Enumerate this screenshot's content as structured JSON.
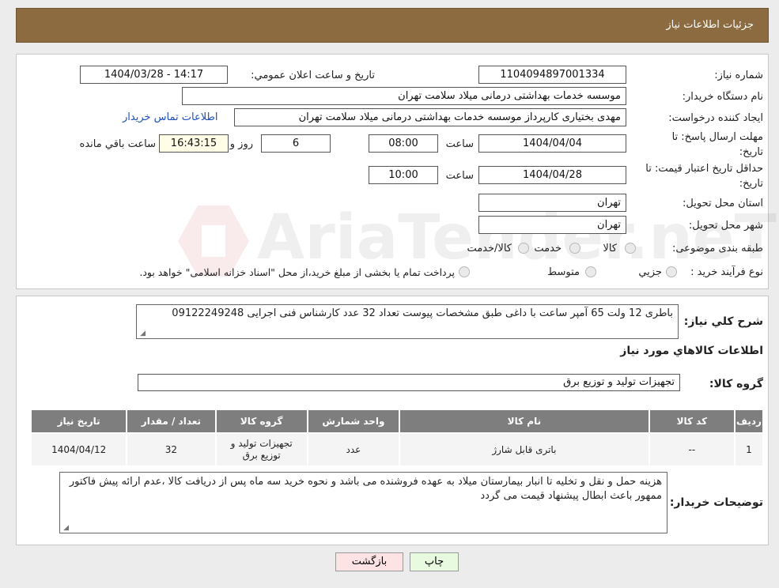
{
  "header": {
    "title": "جزئیات اطلاعات نیاز"
  },
  "watermark_text": "AriaTender.neT",
  "fields": {
    "need_number": {
      "label": "شماره نیاز:",
      "value": "1104094897001334"
    },
    "announce_datetime": {
      "label": "تاریخ و ساعت اعلان عمومي:",
      "value": "1404/03/28 - 14:17"
    },
    "buyer_org": {
      "label": "نام دستگاه خریدار:",
      "value": "موسسه خدمات بهداشتی درمانی میلاد سلامت تهران"
    },
    "requester": {
      "label": "ایجاد کننده درخواست:",
      "value": "مهدی بختیاری کارپرداز موسسه خدمات بهداشتی درمانی میلاد سلامت تهران"
    },
    "buyer_contact_link": "اطلاعات تماس خریدار",
    "reply_deadline": {
      "label_line1": "مهلت ارسال پاسخ: تا",
      "label_line2": "تاریخ:",
      "date": "1404/04/04",
      "time_label": "ساعت",
      "time": "08:00",
      "days": "6",
      "days_label": "روز و",
      "remaining": "16:43:15",
      "remaining_label": "ساعت باقي مانده"
    },
    "price_validity": {
      "label_line1": "حداقل تاریخ اعتبار قیمت: تا",
      "label_line2": "تاریخ:",
      "date": "1404/04/28",
      "time_label": "ساعت",
      "time": "10:00"
    },
    "delivery_province": {
      "label": "استان محل تحویل:",
      "value": "تهران"
    },
    "delivery_city": {
      "label": "شهر محل تحویل:",
      "value": "تهران"
    },
    "category": {
      "label": "طبقه بندی موضوعی:",
      "options": [
        "کالا",
        "خدمت",
        "کالا/خدمت"
      ]
    },
    "purchase_process": {
      "label": "نوع فرآیند خرید :",
      "options": [
        "جزیي",
        "متوسط"
      ],
      "note": "پرداخت تمام یا بخشی از مبلغ خرید،از محل \"اسناد خزانه اسلامی\" خواهد بود."
    }
  },
  "summary": {
    "label": "شرح کلي نیاز:",
    "text": "باطری 12 ولت 65 آمپر ساعت با داغی طبق مشخصات پیوست تعداد 32 عدد کارشناس فنی اجرایی 09122249248"
  },
  "goods_info_title": "اطلاعات کالاهاي مورد نیاز",
  "goods_group": {
    "label": "گروه کالا:",
    "value": "تجهیزات تولید و توزیع برق"
  },
  "table": {
    "headers": [
      "ردیف",
      "کد کالا",
      "نام کالا",
      "واحد شمارش",
      "گروه کالا",
      "تعداد / مقدار",
      "تاریخ نیاز"
    ],
    "rows": [
      [
        "1",
        "--",
        "باتری قابل شارژ",
        "عدد",
        "تجهیزات تولید و توزیع برق",
        "32",
        "1404/04/12"
      ]
    ]
  },
  "buyer_notes": {
    "label": "توضیحات خریدار:",
    "text": "هزینه حمل و نقل و تخلیه تا انبار بیمارستان میلاد به عهده فروشنده می باشد و نحوه خرید سه ماه پس از دریافت کالا ،عدم ارائه پیش فاکتور ممهور باعث ابطال پیشنهاد قیمت می گردد"
  },
  "buttons": {
    "print": "چاپ",
    "back": "بازگشت"
  },
  "colors": {
    "header_bg": "#8b6b3f",
    "link": "#1e4fb8",
    "print_bg": "#e8fbe0",
    "back_bg": "#fde3e3"
  }
}
